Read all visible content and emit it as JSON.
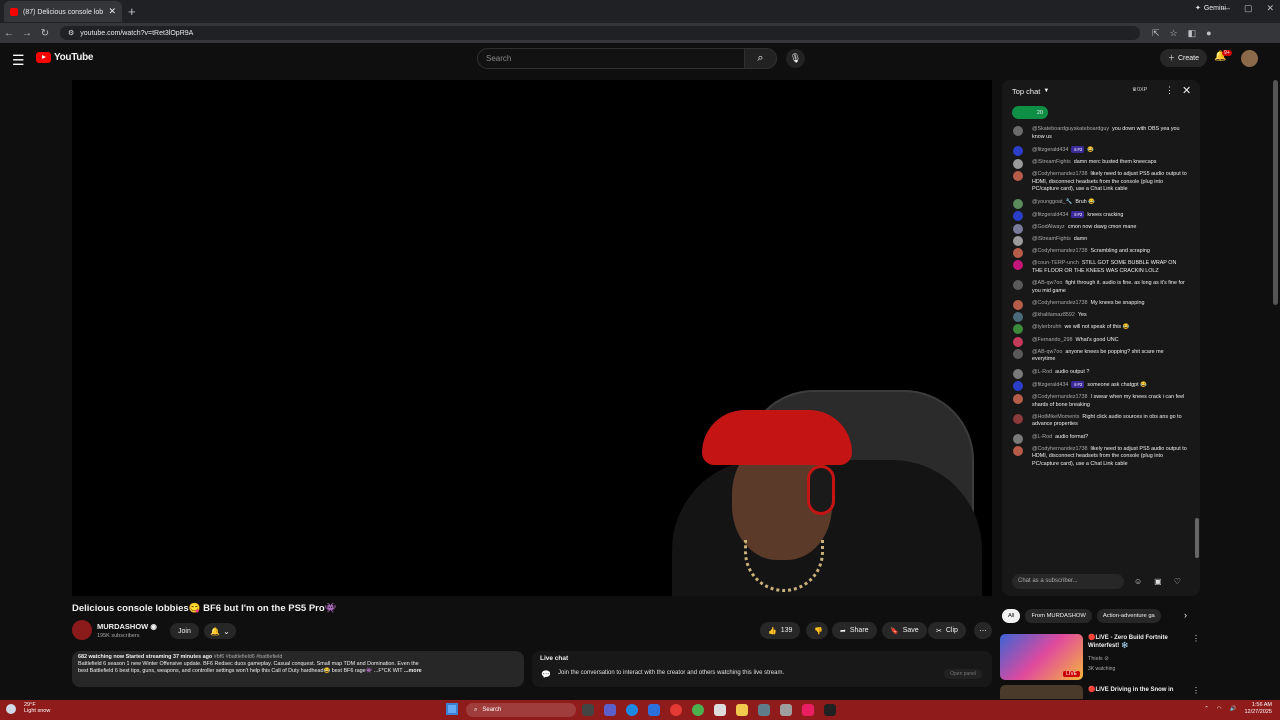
{
  "browser": {
    "tab_title": "(87) Delicious console lobbies😋",
    "new_tab": "+",
    "url": "youtube.com/watch?v=tRet3lOpR9A",
    "gemini_label": "Gemini"
  },
  "header": {
    "logo_text": "YouTube",
    "search_placeholder": "Search",
    "create_label": "Create",
    "notif_count": "9+"
  },
  "video": {
    "title": "Delicious console lobbies😋 BF6 but I'm on the PS5 Pro👾",
    "channel": "MURDASHOW",
    "subscribers": "195K subscribers",
    "join_label": "Join",
    "likes": "139",
    "share_label": "Share",
    "save_label": "Save",
    "clip_label": "Clip"
  },
  "description": {
    "stats": "682 watching now  Started streaming 37 minutes ago",
    "hashtags": "#bf6 #battlefield6 #battlefield",
    "line1": "Battlefield 6 season 1 new Winter Offensive update. BF6 Redsec duos gameplay. Casual conquest. Small map TDM and Domination. Even the",
    "line2": "best Battlefield 6 best tips, guns, weapons, and controller settings won't help this Call of Duty hardhead😂 best BF6 rage👾 ...F*CK WIT",
    "more": "...more"
  },
  "live_chat_box": {
    "title": "Live chat",
    "text": "Join the conversation to interact with the creator and others watching this live stream.",
    "open_panel": "Open panel"
  },
  "chat": {
    "header": "Top chat",
    "xp": "0XP",
    "pinned_count": "20",
    "input_placeholder": "Chat as a subscriber...",
    "messages": [
      {
        "author": "@Skateboardguyskateboardguy",
        "badge": "",
        "text": "you down with OBS yea you know us",
        "color": "#6b6b6b"
      },
      {
        "author": "@fitzgerald434",
        "badge": "♕#2",
        "text": "😂",
        "color": "#2a3ec9"
      },
      {
        "author": "@iStreamFights",
        "badge": "",
        "text": "damn merc busted them kneecaps",
        "color": "#9a9a9a"
      },
      {
        "author": "@Codyhernandez1738",
        "badge": "",
        "text": "likely need to adjust PS5 audio output to HDMI, disconnect headsets from the console (plug into PC/capture card), use a Chat Link cable",
        "color": "#b85c4a"
      },
      {
        "author": "@younggoat_🔧",
        "badge": "",
        "text": "Bruh 😂",
        "color": "#5b8a5b"
      },
      {
        "author": "@fitzgerald434",
        "badge": "♕#2",
        "text": "knees cracking",
        "color": "#2a3ec9"
      },
      {
        "author": "@GodAlwayz",
        "badge": "",
        "text": "cmon now dawg cmon mane",
        "color": "#7a7a9a"
      },
      {
        "author": "@iStreamFights",
        "badge": "",
        "text": "damn",
        "color": "#9a9a9a"
      },
      {
        "author": "@Codyhernandez1738",
        "badge": "",
        "text": "Scrambling and scraping",
        "color": "#b85c4a"
      },
      {
        "author": "@coun-TERP-unch",
        "badge": "",
        "text": "STILL GOT SOME BUBBLE WRAP ON THE FLOOR OR THE KNEES WAS CRACKIN LOLZ",
        "color": "#c4157a"
      },
      {
        "author": "@AB-qw7oo",
        "badge": "",
        "text": "fight through it. audio is fine. as long as it's fine for you mid game",
        "color": "#5a5a5a"
      },
      {
        "author": "@Codyhernandez1738",
        "badge": "",
        "text": "My knees be snapping",
        "color": "#b85c4a"
      },
      {
        "author": "@khalilamaz8592",
        "badge": "",
        "text": "Yes",
        "color": "#4a6a7a"
      },
      {
        "author": "@tylerbruhh",
        "badge": "",
        "text": "we will not speak of this 😂",
        "color": "#3a8a3a"
      },
      {
        "author": "@Fernando_298",
        "badge": "",
        "text": "What's good UNC",
        "color": "#c43a5a"
      },
      {
        "author": "@AB-qw7oo",
        "badge": "",
        "text": "anyone knees be popping? shit scare me everytime",
        "color": "#5a5a5a"
      },
      {
        "author": "@L-Rod",
        "badge": "",
        "text": "audio output ?",
        "color": "#7a7a7a"
      },
      {
        "author": "@fitzgerald434",
        "badge": "♕#2",
        "text": "someone ask chatgpt 😂",
        "color": "#2a3ec9"
      },
      {
        "author": "@Codyhernandez1738",
        "badge": "",
        "text": "I swear when my knees crack i can feel shards of bone breaking",
        "color": "#b85c4a"
      },
      {
        "author": "@HotMikeMoments",
        "badge": "",
        "text": "Right click audio sources in obs ans go to advance properties",
        "color": "#8a3a3a"
      },
      {
        "author": "@L-Rod",
        "badge": "",
        "text": "audio format?",
        "color": "#7a7a7a"
      },
      {
        "author": "@Codyhernandez1738",
        "badge": "",
        "text": "likely need to adjust PS5 audio output to HDMI, disconnect headsets from the console (plug into PC/capture card), use a Chat Link cable",
        "color": "#b85c4a"
      }
    ]
  },
  "chips": [
    "All",
    "From MURDASHOW",
    "Action-adventure ga"
  ],
  "recommendations": [
    {
      "title": "🔴LIVE - Zero Build Fortnite Winterfest! ❄️",
      "channel": "Thiels ⊘",
      "watching": "3K watching",
      "live_badge": "LIVE"
    },
    {
      "title": "🔴LIVE Driving in the Snow in"
    }
  ],
  "taskbar": {
    "temp": "29°F",
    "weather": "Light snow",
    "search_label": "Search",
    "time": "1:56 AM",
    "date": "12/27/2025"
  }
}
